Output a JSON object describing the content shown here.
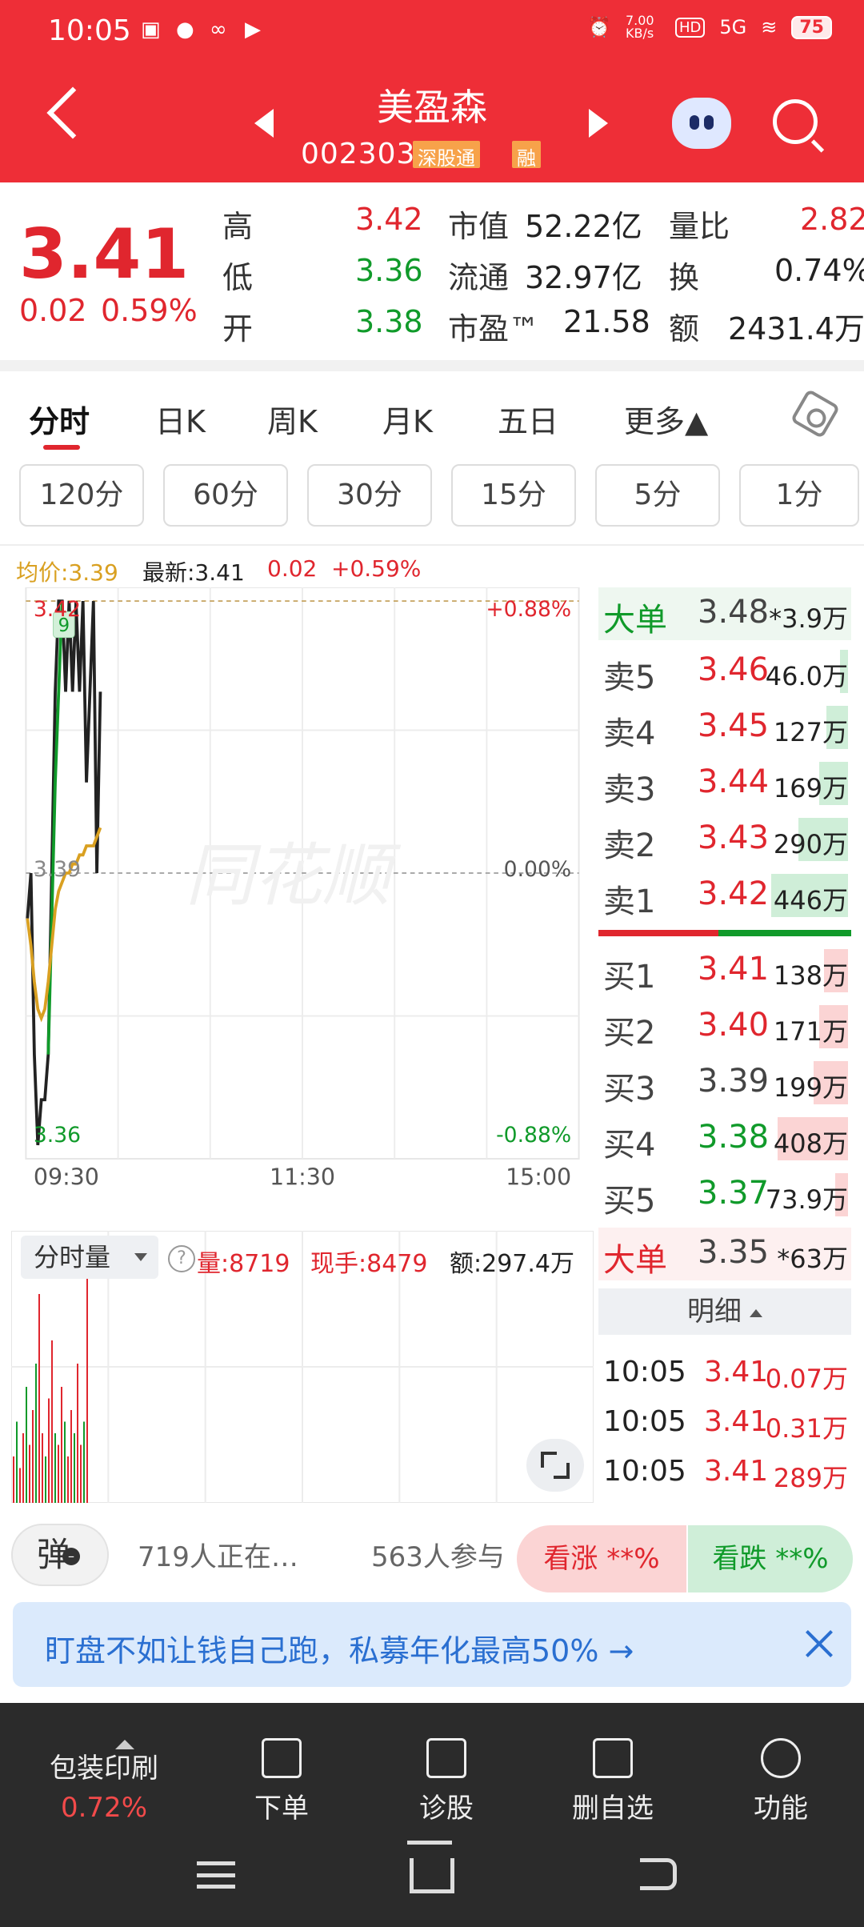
{
  "status_bar": {
    "time": "10:05",
    "network_speed": "7.00 KB/s",
    "hd": "HD",
    "signal": "5G",
    "battery": "75"
  },
  "header": {
    "name": "美盈森",
    "code": "002303",
    "tags": [
      "深股通",
      "融"
    ]
  },
  "quote": {
    "price": "3.41",
    "change": "0.02",
    "change_pct": "0.59%",
    "rows": [
      {
        "l1": "高",
        "v1": "3.42",
        "l2": "市值",
        "v2": "52.22亿",
        "l3": "量比",
        "v3": "2.82"
      },
      {
        "l1": "低",
        "v1": "3.36",
        "l2": "流通",
        "v2": "32.97亿",
        "l3": "换",
        "v3": "0.74%"
      },
      {
        "l1": "开",
        "v1": "3.38",
        "l2": "市盈™",
        "v2": "21.58",
        "l3": "额",
        "v3": "2431.4万"
      }
    ]
  },
  "tabs": [
    "分时",
    "日K",
    "周K",
    "月K",
    "五日",
    "更多▲"
  ],
  "periods": [
    "120分",
    "60分",
    "30分",
    "15分",
    "5分",
    "1分"
  ],
  "infoline": {
    "avg_label": "均价:3.39",
    "latest_label": "最新:3.41",
    "change": "0.02",
    "pct": "+0.59%"
  },
  "chart_data": {
    "type": "line",
    "title": "",
    "x_ticks": [
      "09:30",
      "11:30",
      "15:00"
    ],
    "y_left_ticks": [
      "3.42",
      "3.39",
      "3.36"
    ],
    "y_right_ticks": [
      "+0.88%",
      "0.00%",
      "-0.88%"
    ],
    "ylim": [
      3.36,
      3.42
    ],
    "marker_label": "9",
    "watermark": "同花顺",
    "series": [
      {
        "color": "#222222",
        "values": [
          3.385,
          3.39,
          3.37,
          3.36,
          3.365,
          3.365,
          3.37,
          3.39,
          3.41,
          3.42,
          3.42,
          3.41,
          3.42,
          3.41,
          3.42,
          3.41,
          3.42,
          3.4,
          3.41,
          3.42,
          3.39,
          3.41
        ]
      },
      {
        "color": "#109a2a",
        "values": [
          null,
          null,
          null,
          null,
          null,
          null,
          3.37,
          3.385,
          3.4,
          3.41,
          3.42
        ]
      },
      {
        "color": "#d9a021",
        "values": [
          3.385,
          3.382,
          3.378,
          3.375,
          3.374,
          3.375,
          3.378,
          3.382,
          3.386,
          3.388,
          3.389,
          3.39,
          3.39,
          3.391,
          3.391,
          3.392,
          3.392,
          3.393,
          3.393,
          3.393,
          3.394,
          3.395
        ]
      }
    ]
  },
  "volume": {
    "mode": "分时量",
    "vol": "量:8719",
    "current": "现手:8479",
    "amount": "额:297.4万",
    "bars": [
      0.2,
      0.35,
      0.15,
      0.3,
      0.5,
      0.25,
      0.4,
      0.6,
      0.9,
      0.3,
      0.2,
      0.45,
      0.7,
      0.3,
      0.25,
      0.5,
      0.35,
      0.2,
      0.4,
      0.3,
      0.6,
      0.25,
      0.35,
      1.0
    ]
  },
  "book": {
    "big_sell": {
      "label": "大单",
      "price": "3.48",
      "vol": "*3.9万"
    },
    "asks": [
      {
        "label": "卖5",
        "price": "3.46",
        "vol": "46.0万",
        "ratio": 0.1
      },
      {
        "label": "卖4",
        "price": "3.45",
        "vol": "127万",
        "ratio": 0.28
      },
      {
        "label": "卖3",
        "price": "3.44",
        "vol": "169万",
        "ratio": 0.38
      },
      {
        "label": "卖2",
        "price": "3.43",
        "vol": "290万",
        "ratio": 0.65
      },
      {
        "label": "卖1",
        "price": "3.42",
        "vol": "446万",
        "ratio": 1.0
      }
    ],
    "bids": [
      {
        "label": "买1",
        "price": "3.41",
        "vol": "138万",
        "ratio": 0.31
      },
      {
        "label": "买2",
        "price": "3.40",
        "vol": "171万",
        "ratio": 0.38
      },
      {
        "label": "买3",
        "price": "3.39",
        "vol": "199万",
        "ratio": 0.45
      },
      {
        "label": "买4",
        "price": "3.38",
        "vol": "408万",
        "ratio": 0.92
      },
      {
        "label": "买5",
        "price": "3.37",
        "vol": "73.9万",
        "ratio": 0.17
      }
    ],
    "big_buy": {
      "label": "大单",
      "price": "3.35",
      "vol": "*63万"
    },
    "detail_label": "明细",
    "ticks": [
      {
        "time": "10:05",
        "price": "3.41",
        "vol": "0.07万"
      },
      {
        "time": "10:05",
        "price": "3.41",
        "vol": "0.31万"
      },
      {
        "time": "10:05",
        "price": "3.41",
        "vol": "289万"
      }
    ]
  },
  "poll": {
    "danmu": "弹",
    "watching": "719人正在…",
    "participants": "563人参与",
    "up": "看涨 **%",
    "down": "看跌 **%"
  },
  "ad": {
    "text": "盯盘不如让钱自己跑，私募年化最高50% →"
  },
  "bottom": {
    "sector_name": "包装印刷",
    "sector_pct": "0.72%",
    "items": [
      "下单",
      "诊股",
      "删自选",
      "功能"
    ]
  },
  "colors": {
    "header_red": "#ee2e37",
    "up_red": "#e0262e",
    "down_green": "#109a2a",
    "avg_line": "#d9a021"
  }
}
